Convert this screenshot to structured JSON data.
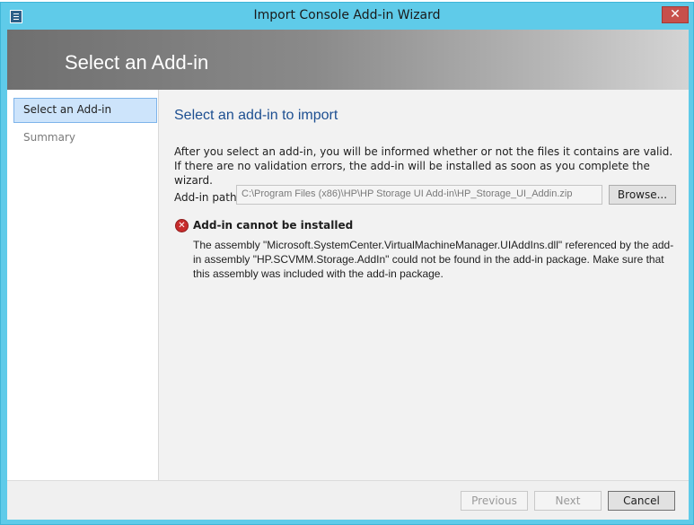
{
  "window": {
    "title": "Import Console Add-in Wizard",
    "close_glyph": "✕",
    "app_icon": "wizard-icon"
  },
  "banner": {
    "title": "Select an Add-in"
  },
  "nav": {
    "items": [
      {
        "label": "Select an Add-in",
        "active": true
      },
      {
        "label": "Summary",
        "active": false
      }
    ]
  },
  "main": {
    "heading": "Select an add-in to import",
    "description": "After you select an add-in, you will be informed whether or not the files it contains are valid. If there are no validation errors, the add-in will be installed as soon as you complete the wizard.",
    "path_label": "Add-in path:",
    "path_value": "C:\\Program Files (x86)\\HP\\HP Storage UI Add-in\\HP_Storage_UI_Addin.zip",
    "browse_label": "Browse...",
    "error": {
      "icon": "error-icon",
      "title": "Add-in cannot be installed",
      "message": "The assembly \"Microsoft.SystemCenter.VirtualMachineManager.UIAddIns.dll\" referenced by the add-in assembly \"HP.SCVMM.Storage.AddIn\" could not be found in the add-in package. Make sure that this assembly was included with the add-in package."
    }
  },
  "footer": {
    "previous_label": "Previous",
    "next_label": "Next",
    "cancel_label": "Cancel"
  },
  "colors": {
    "titlebar": "#5fcbe9",
    "close_button": "#c7504b",
    "heading": "#1d4f91",
    "nav_selected": "#cde4fb",
    "error": "#c72c2c"
  }
}
